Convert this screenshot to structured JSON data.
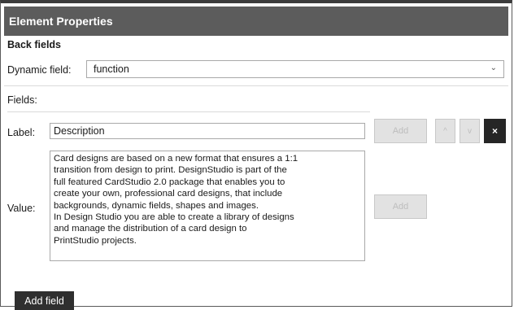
{
  "panel": {
    "title": "Element Properties"
  },
  "back_fields": {
    "section_title": "Back fields",
    "dynamic_field_label": "Dynamic field:",
    "dynamic_field_value": "function",
    "fields_label": "Fields:",
    "label_label": "Label:",
    "label_value": "Description",
    "value_label": "Value:",
    "value_lines": [
      "Card designs are based on a new format that ensures a 1:1",
      "transition from design to print. DesignStudio is part of the",
      "full featured CardStudio 2.0 package that enables you to",
      "create your own, professional card designs, that include",
      "backgrounds, dynamic fields, shapes and images.",
      "In Design Studio you are able to create a library of designs",
      "and manage the distribution of a card design to",
      "PrintStudio projects."
    ]
  },
  "buttons": {
    "add_label": "Add",
    "add_value": "Add",
    "move_up": "^",
    "move_down": "v",
    "delete": "×",
    "add_field": "Add field"
  },
  "icons": {
    "dropdown": "chevron-down-icon"
  },
  "colors": {
    "titlebar": "#5c5c5c",
    "dark_button": "#2f2f2f",
    "disabled_button": "#e2e2e2"
  }
}
